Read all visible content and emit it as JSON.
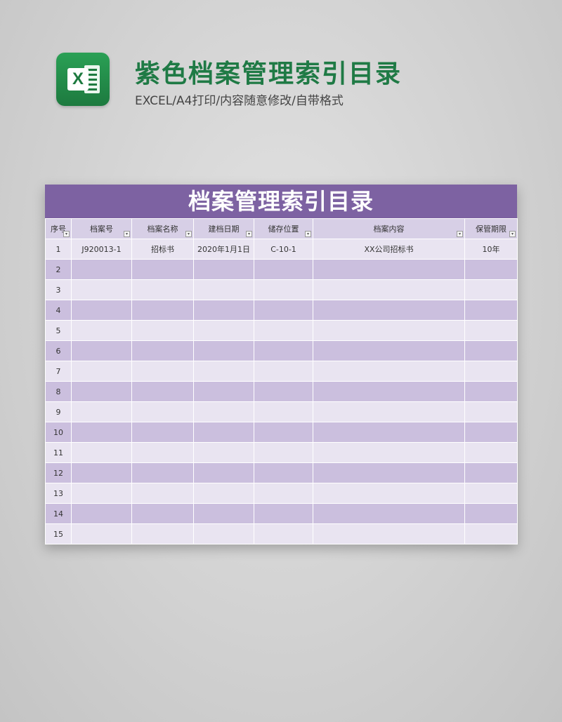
{
  "header": {
    "title": "紫色档案管理索引目录",
    "subtitle": "EXCEL/A4打印/内容随意修改/自带格式",
    "logo_letter": "X",
    "logo_icon": "excel-icon"
  },
  "sheet": {
    "title": "档案管理索引目录",
    "colors": {
      "banner": "#7d62a2",
      "header_row": "#d7cfe6",
      "row_light": "#e9e4f1",
      "row_dark": "#cbbfde",
      "title_green": "#1f7a45"
    },
    "columns": [
      "序号",
      "档案号",
      "档案名称",
      "建档日期",
      "储存位置",
      "档案内容",
      "保管期限"
    ],
    "filter_glyph": "▾",
    "rows": [
      [
        "1",
        "J920013-1",
        "招标书",
        "2020年1月1日",
        "C-10-1",
        "XX公司招标书",
        "10年"
      ],
      [
        "2",
        "",
        "",
        "",
        "",
        "",
        ""
      ],
      [
        "3",
        "",
        "",
        "",
        "",
        "",
        ""
      ],
      [
        "4",
        "",
        "",
        "",
        "",
        "",
        ""
      ],
      [
        "5",
        "",
        "",
        "",
        "",
        "",
        ""
      ],
      [
        "6",
        "",
        "",
        "",
        "",
        "",
        ""
      ],
      [
        "7",
        "",
        "",
        "",
        "",
        "",
        ""
      ],
      [
        "8",
        "",
        "",
        "",
        "",
        "",
        ""
      ],
      [
        "9",
        "",
        "",
        "",
        "",
        "",
        ""
      ],
      [
        "10",
        "",
        "",
        "",
        "",
        "",
        ""
      ],
      [
        "11",
        "",
        "",
        "",
        "",
        "",
        ""
      ],
      [
        "12",
        "",
        "",
        "",
        "",
        "",
        ""
      ],
      [
        "13",
        "",
        "",
        "",
        "",
        "",
        ""
      ],
      [
        "14",
        "",
        "",
        "",
        "",
        "",
        ""
      ],
      [
        "15",
        "",
        "",
        "",
        "",
        "",
        ""
      ]
    ]
  }
}
